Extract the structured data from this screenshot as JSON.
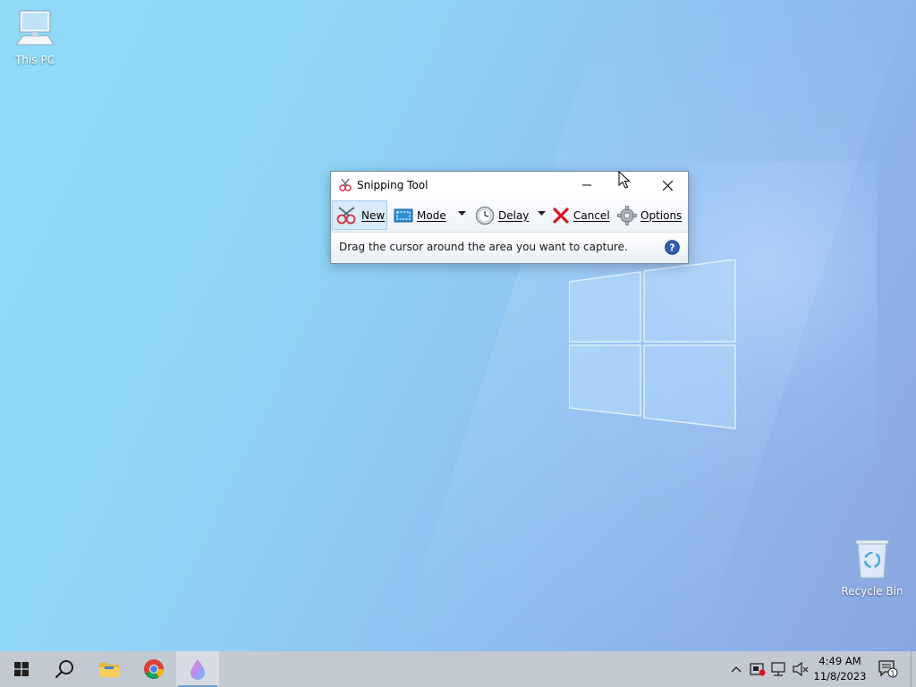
{
  "desktop": {
    "icons": [
      {
        "label": "This PC"
      },
      {
        "label": "Recycle Bin"
      }
    ]
  },
  "snipping_tool": {
    "title": "Snipping Tool",
    "toolbar": {
      "new_label": "New",
      "mode_label": "Mode",
      "delay_label": "Delay",
      "cancel_label": "Cancel",
      "options_label": "Options"
    },
    "status_message": "Drag the cursor around the area you want to capture."
  },
  "taskbar": {
    "apps": [
      "start-icon",
      "search-icon",
      "file-explorer-icon",
      "chrome-icon",
      "paint-icon"
    ],
    "clock": {
      "time": "4:49 AM",
      "date": "11/8/2023"
    },
    "notification_count": "1"
  },
  "colors": {
    "accent": "#6aa0d8",
    "taskbar": "#c2c9d3",
    "cancel_red": "#d9141e"
  }
}
